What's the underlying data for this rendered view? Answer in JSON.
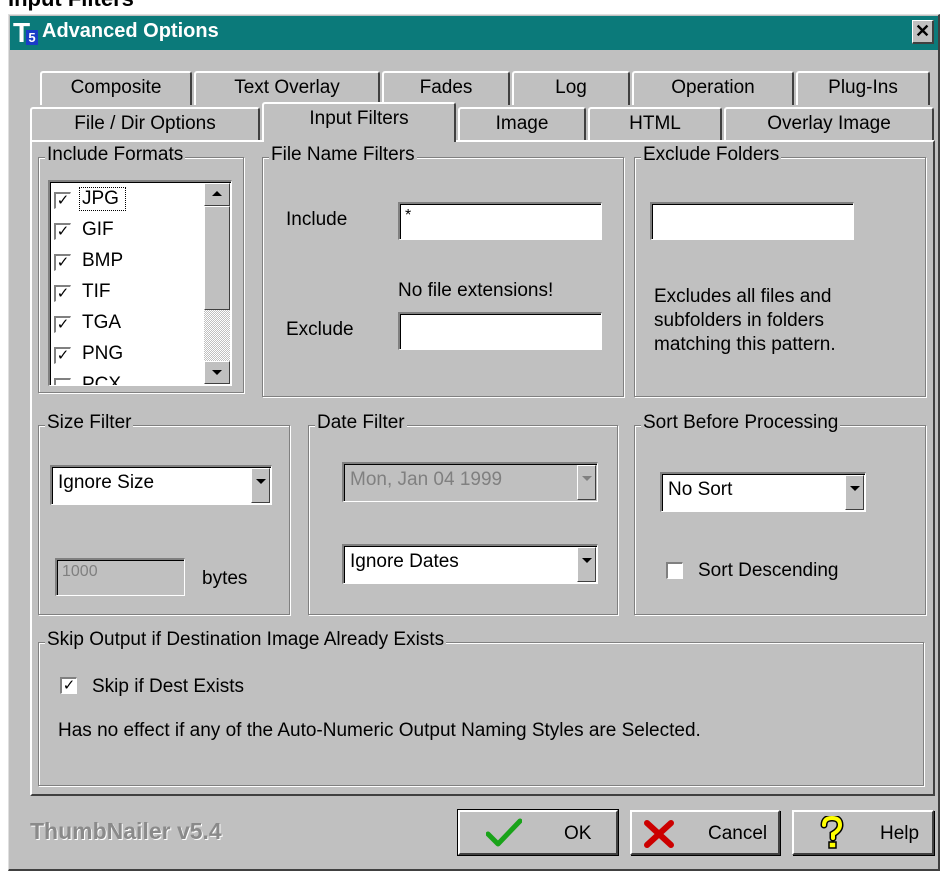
{
  "page_heading": "Input Filters",
  "window": {
    "title": "Advanced Options",
    "logo_letter": "T",
    "logo_number": "5",
    "close_glyph": "✕"
  },
  "tabs_row1": [
    {
      "label": "Composite"
    },
    {
      "label": "Text Overlay"
    },
    {
      "label": "Fades"
    },
    {
      "label": "Log"
    },
    {
      "label": "Operation"
    },
    {
      "label": "Plug-Ins"
    }
  ],
  "tabs_row2": [
    {
      "label": "File / Dir Options"
    },
    {
      "label": "Input Filters",
      "active": true
    },
    {
      "label": "Image"
    },
    {
      "label": "HTML"
    },
    {
      "label": "Overlay Image"
    }
  ],
  "include_formats": {
    "legend": "Include Formats",
    "items": [
      {
        "label": "JPG",
        "checked": true
      },
      {
        "label": "GIF",
        "checked": true
      },
      {
        "label": "BMP",
        "checked": true
      },
      {
        "label": "TIF",
        "checked": true
      },
      {
        "label": "TGA",
        "checked": true
      },
      {
        "label": "PNG",
        "checked": true
      },
      {
        "label": "PCX",
        "checked": false
      }
    ],
    "check_glyph": "✓"
  },
  "file_name_filters": {
    "legend": "File Name Filters",
    "include_label": "Include",
    "include_value": "*",
    "note": "No file extensions!",
    "exclude_label": "Exclude",
    "exclude_value": ""
  },
  "exclude_folders": {
    "legend": "Exclude Folders",
    "value": "",
    "description_lines": [
      "Excludes all files and",
      "subfolders in folders",
      "matching this pattern."
    ]
  },
  "size_filter": {
    "legend": "Size Filter",
    "selected": "Ignore Size",
    "bytes_value": "1000",
    "bytes_label": "bytes"
  },
  "date_filter": {
    "legend": "Date Filter",
    "date_value": "Mon, Jan 04 1999",
    "selected": "Ignore Dates"
  },
  "sort": {
    "legend": "Sort Before Processing",
    "selected": "No Sort",
    "descending_label": "Sort Descending",
    "descending_checked": false
  },
  "skip_output": {
    "legend": "Skip Output if Destination Image Already Exists",
    "checkbox_label": "Skip if Dest Exists",
    "checked": true,
    "note": "Has no effect if any of the Auto-Numeric Output Naming Styles are Selected."
  },
  "footer": {
    "brand": "ThumbNailer v5.4",
    "ok_label": "OK",
    "cancel_label": "Cancel",
    "help_label": "Help",
    "ok_icon": "check-icon",
    "cancel_icon": "x-icon",
    "help_icon": "question-icon",
    "colors": {
      "ok_icon": "#19a319",
      "cancel_icon": "#cc0000",
      "help_icon": "#ffff00",
      "titlebar": "#0b7a7a"
    }
  }
}
